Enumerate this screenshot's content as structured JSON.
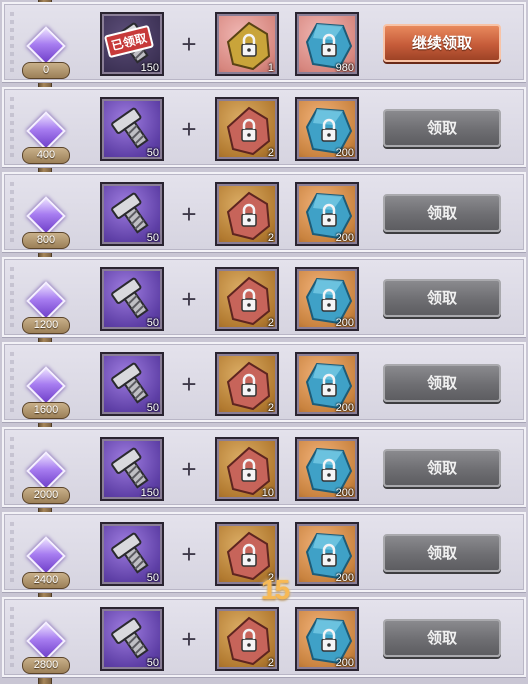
{
  "milestones": [
    {
      "threshold": "0",
      "bolt_qty": "150",
      "stamp": "已领取",
      "claimed": true,
      "shard_qty": "1",
      "crystal_qty": "980",
      "button": "继续领取",
      "button_state": "active"
    },
    {
      "threshold": "400",
      "bolt_qty": "50",
      "claimed": false,
      "shard_qty": "2",
      "crystal_qty": "200",
      "button": "领取",
      "button_state": "disabled"
    },
    {
      "threshold": "800",
      "bolt_qty": "50",
      "claimed": false,
      "shard_qty": "2",
      "crystal_qty": "200",
      "button": "领取",
      "button_state": "disabled"
    },
    {
      "threshold": "1200",
      "bolt_qty": "50",
      "claimed": false,
      "shard_qty": "2",
      "crystal_qty": "200",
      "button": "领取",
      "button_state": "disabled"
    },
    {
      "threshold": "1600",
      "bolt_qty": "50",
      "claimed": false,
      "shard_qty": "2",
      "crystal_qty": "200",
      "button": "领取",
      "button_state": "disabled"
    },
    {
      "threshold": "2000",
      "bolt_qty": "150",
      "claimed": false,
      "shard_qty": "10",
      "crystal_qty": "200",
      "button": "领取",
      "button_state": "disabled"
    },
    {
      "threshold": "2400",
      "bolt_qty": "50",
      "claimed": false,
      "shard_qty": "2",
      "crystal_qty": "200",
      "button": "领取",
      "button_state": "disabled"
    },
    {
      "threshold": "2800",
      "bolt_qty": "50",
      "claimed": false,
      "shard_qty": "2",
      "crystal_qty": "200",
      "button": "领取",
      "button_state": "disabled"
    }
  ],
  "plus_sign": "+",
  "combo_text": "15",
  "icons": {
    "milestone": "purple-diamond-gem-icon",
    "reward_1": "metal-bolt-icon",
    "reward_2": "locked-shard-icon",
    "reward_3": "locked-crystal-icon"
  },
  "colors": {
    "active_button": "#c65c3a",
    "disabled_button": "#6e6e72",
    "gem": "#a77df0"
  }
}
